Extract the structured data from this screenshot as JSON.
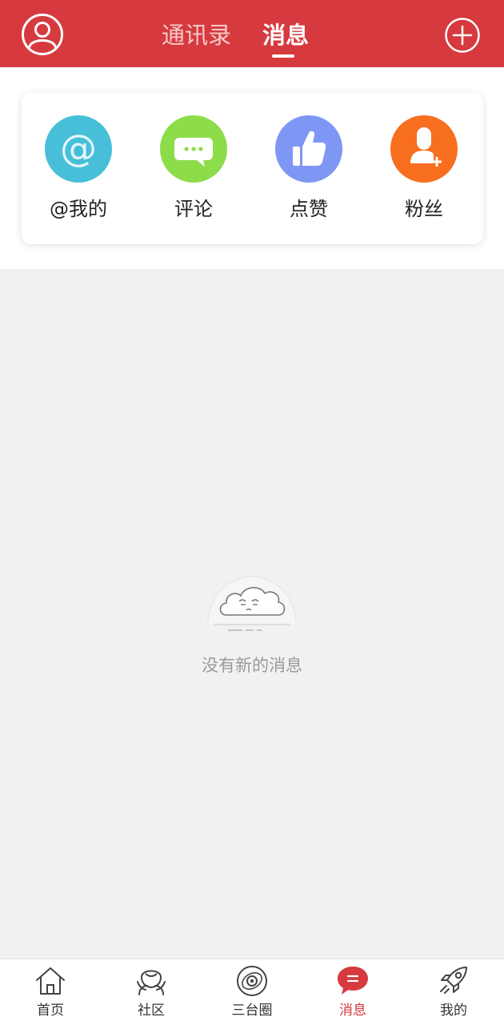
{
  "header": {
    "tabs": [
      {
        "label": "通讯录",
        "active": false
      },
      {
        "label": "消息",
        "active": true
      }
    ],
    "left_icon": "user-avatar-icon",
    "right_icon": "plus-circle-icon",
    "brand_color": "#d63a3e"
  },
  "quick_actions": [
    {
      "label": "@我的",
      "icon": "at-icon",
      "color": "#47bfd9"
    },
    {
      "label": "评论",
      "icon": "comment-icon",
      "color": "#8ddc4a"
    },
    {
      "label": "点赞",
      "icon": "thumbs-up-icon",
      "color": "#7f97f4"
    },
    {
      "label": "粉丝",
      "icon": "add-follower-icon",
      "color": "#f86e1f"
    }
  ],
  "empty_state": {
    "text": "没有新的消息",
    "icon": "sleepy-cloud-icon"
  },
  "bottom_nav": [
    {
      "label": "首页",
      "icon": "home-icon",
      "active": false
    },
    {
      "label": "社区",
      "icon": "community-icon",
      "active": false
    },
    {
      "label": "三台圈",
      "icon": "orbit-icon",
      "active": false
    },
    {
      "label": "消息",
      "icon": "message-bubble-icon",
      "active": true
    },
    {
      "label": "我的",
      "icon": "rocket-icon",
      "active": false
    }
  ]
}
